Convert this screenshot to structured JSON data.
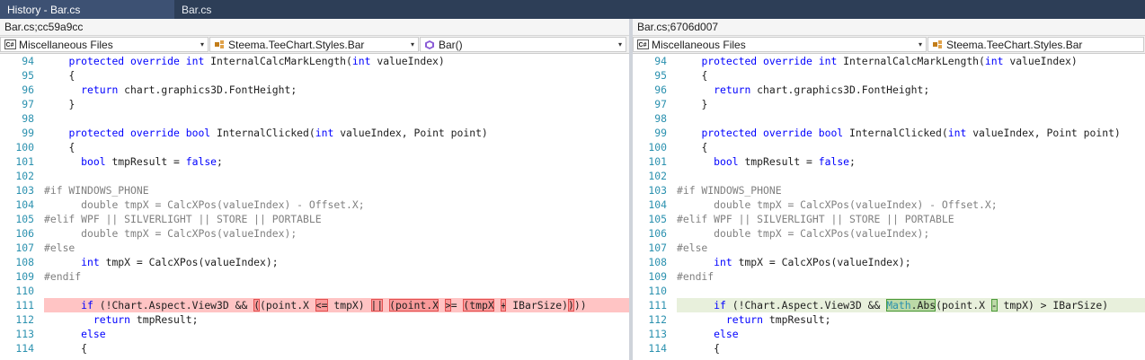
{
  "tabs": [
    {
      "label": "History - Bar.cs"
    },
    {
      "label": "Bar.cs"
    }
  ],
  "left": {
    "path": "Bar.cs;cc59a9cc",
    "combo_project": "Miscellaneous Files",
    "combo_type": "Steema.TeeChart.Styles.Bar",
    "combo_member": "Bar()"
  },
  "right": {
    "path": "Bar.cs;6706d007",
    "combo_project": "Miscellaneous Files",
    "combo_type": "Steema.TeeChart.Styles.Bar"
  },
  "icons": {
    "cs": "C#",
    "class": "class-icon",
    "method": "method-icon",
    "arrow": "▾"
  },
  "code": {
    "line_numbers": [
      "94",
      "95",
      "96",
      "97",
      "98",
      "99",
      "100",
      "101",
      "102",
      "103",
      "104",
      "105",
      "106",
      "107",
      "108",
      "109",
      "110",
      "111",
      "112",
      "113",
      "114"
    ],
    "l94": {
      "kw": "protected override int",
      "rest": " InternalCalcMarkLength(",
      "kw2": "int",
      "rest2": " valueIndex)"
    },
    "l95": "{",
    "l96": {
      "kw": "return",
      "rest": " chart.graphics3D.FontHeight;"
    },
    "l97": "}",
    "l99": {
      "kw": "protected override bool",
      "rest": " InternalClicked(",
      "kw2": "int",
      "rest2": " valueIndex, Point point)"
    },
    "l100": "{",
    "l101": {
      "kw": "bool",
      "rest": " tmpResult = ",
      "kw2": "false",
      "rest2": ";"
    },
    "l103": "#if WINDOWS_PHONE",
    "l104": "double tmpX = CalcXPos(valueIndex) - Offset.X;",
    "l105": "#elif WPF || SILVERLIGHT || STORE || PORTABLE",
    "l106": "double tmpX = CalcXPos(valueIndex);",
    "l107": "#else",
    "l108": {
      "kw": "int",
      "rest": " tmpX = CalcXPos(valueIndex);"
    },
    "l109": "#endif",
    "l111_left": {
      "kw": "if",
      "p1": " (!Chart.Aspect.View3D && ",
      "h1": "(",
      "p2": "(point.X ",
      "h2": "<=",
      "p3": " tmpX) ",
      "h3": "||",
      "p4": " ",
      "h4": "(point.X",
      "p5": " ",
      "h5": ">",
      "p6": "= ",
      "h6": "(tmpX",
      "p7": " ",
      "h7": "+",
      "p8": " IBarSize)",
      "h8": ")",
      "p9": "))"
    },
    "l111_right": {
      "kw": "if",
      "p1": " (!Chart.Aspect.View3D && ",
      "h1a": "Math",
      "h1b": ".Abs",
      "p2": "(point.X ",
      "h2": "-",
      "p3": " tmpX) > IBarSize)"
    },
    "l112": {
      "kw": "return",
      "rest": " tmpResult;"
    },
    "l113": "else",
    "l114": "{"
  }
}
